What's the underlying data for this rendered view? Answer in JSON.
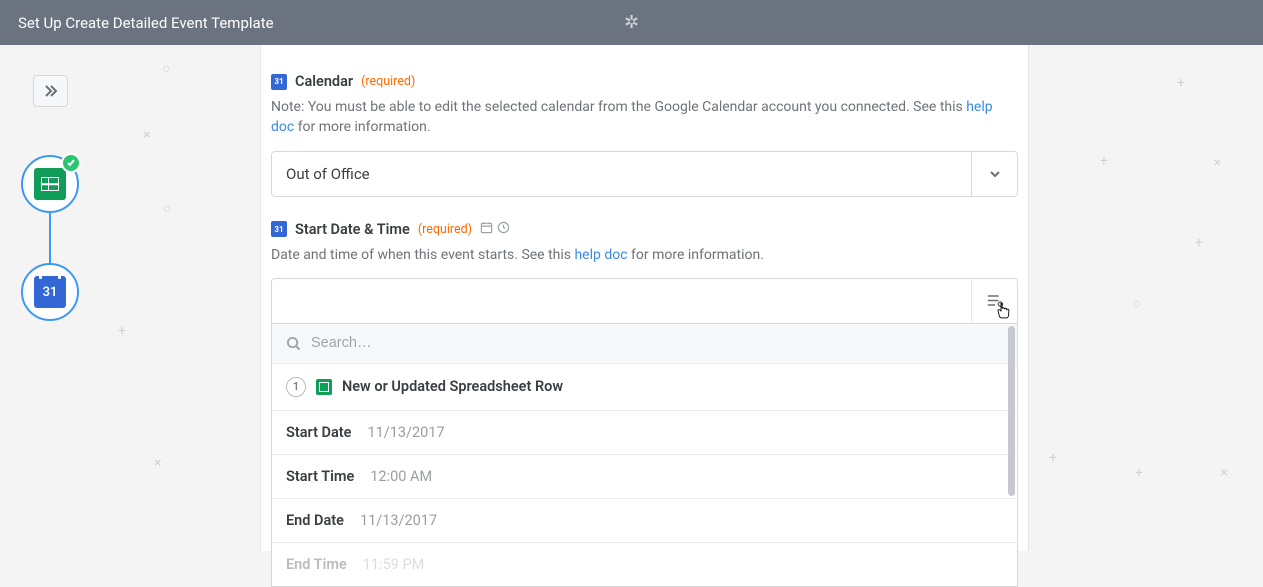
{
  "header": {
    "title": "Set Up Create Detailed Event Template"
  },
  "steps": {
    "step1": {
      "icon": "google-sheets",
      "checked": true
    },
    "step2": {
      "icon": "google-calendar",
      "number": "31"
    }
  },
  "fields": {
    "calendar": {
      "icon_number": "31",
      "label": "Calendar",
      "required_text": "(required)",
      "help_prefix": "Note: You must be able to edit the selected calendar from the Google Calendar account you connected. See this ",
      "help_link": "help doc",
      "help_suffix": " for more information.",
      "value": "Out of Office"
    },
    "start": {
      "icon_number": "31",
      "label": "Start Date & Time",
      "required_text": "(required)",
      "help_prefix": "Date and time of when this event starts. See this ",
      "help_link": "help doc",
      "help_suffix": " for more information."
    }
  },
  "dropdown": {
    "search_placeholder": "Search…",
    "source_step_num": "1",
    "source_title": "New or Updated Spreadsheet Row",
    "options": [
      {
        "key": "Start Date",
        "value": "11/13/2017"
      },
      {
        "key": "Start Time",
        "value": "12:00 AM"
      },
      {
        "key": "End Date",
        "value": "11/13/2017"
      },
      {
        "key": "End Time",
        "value": "11:59 PM"
      }
    ]
  }
}
